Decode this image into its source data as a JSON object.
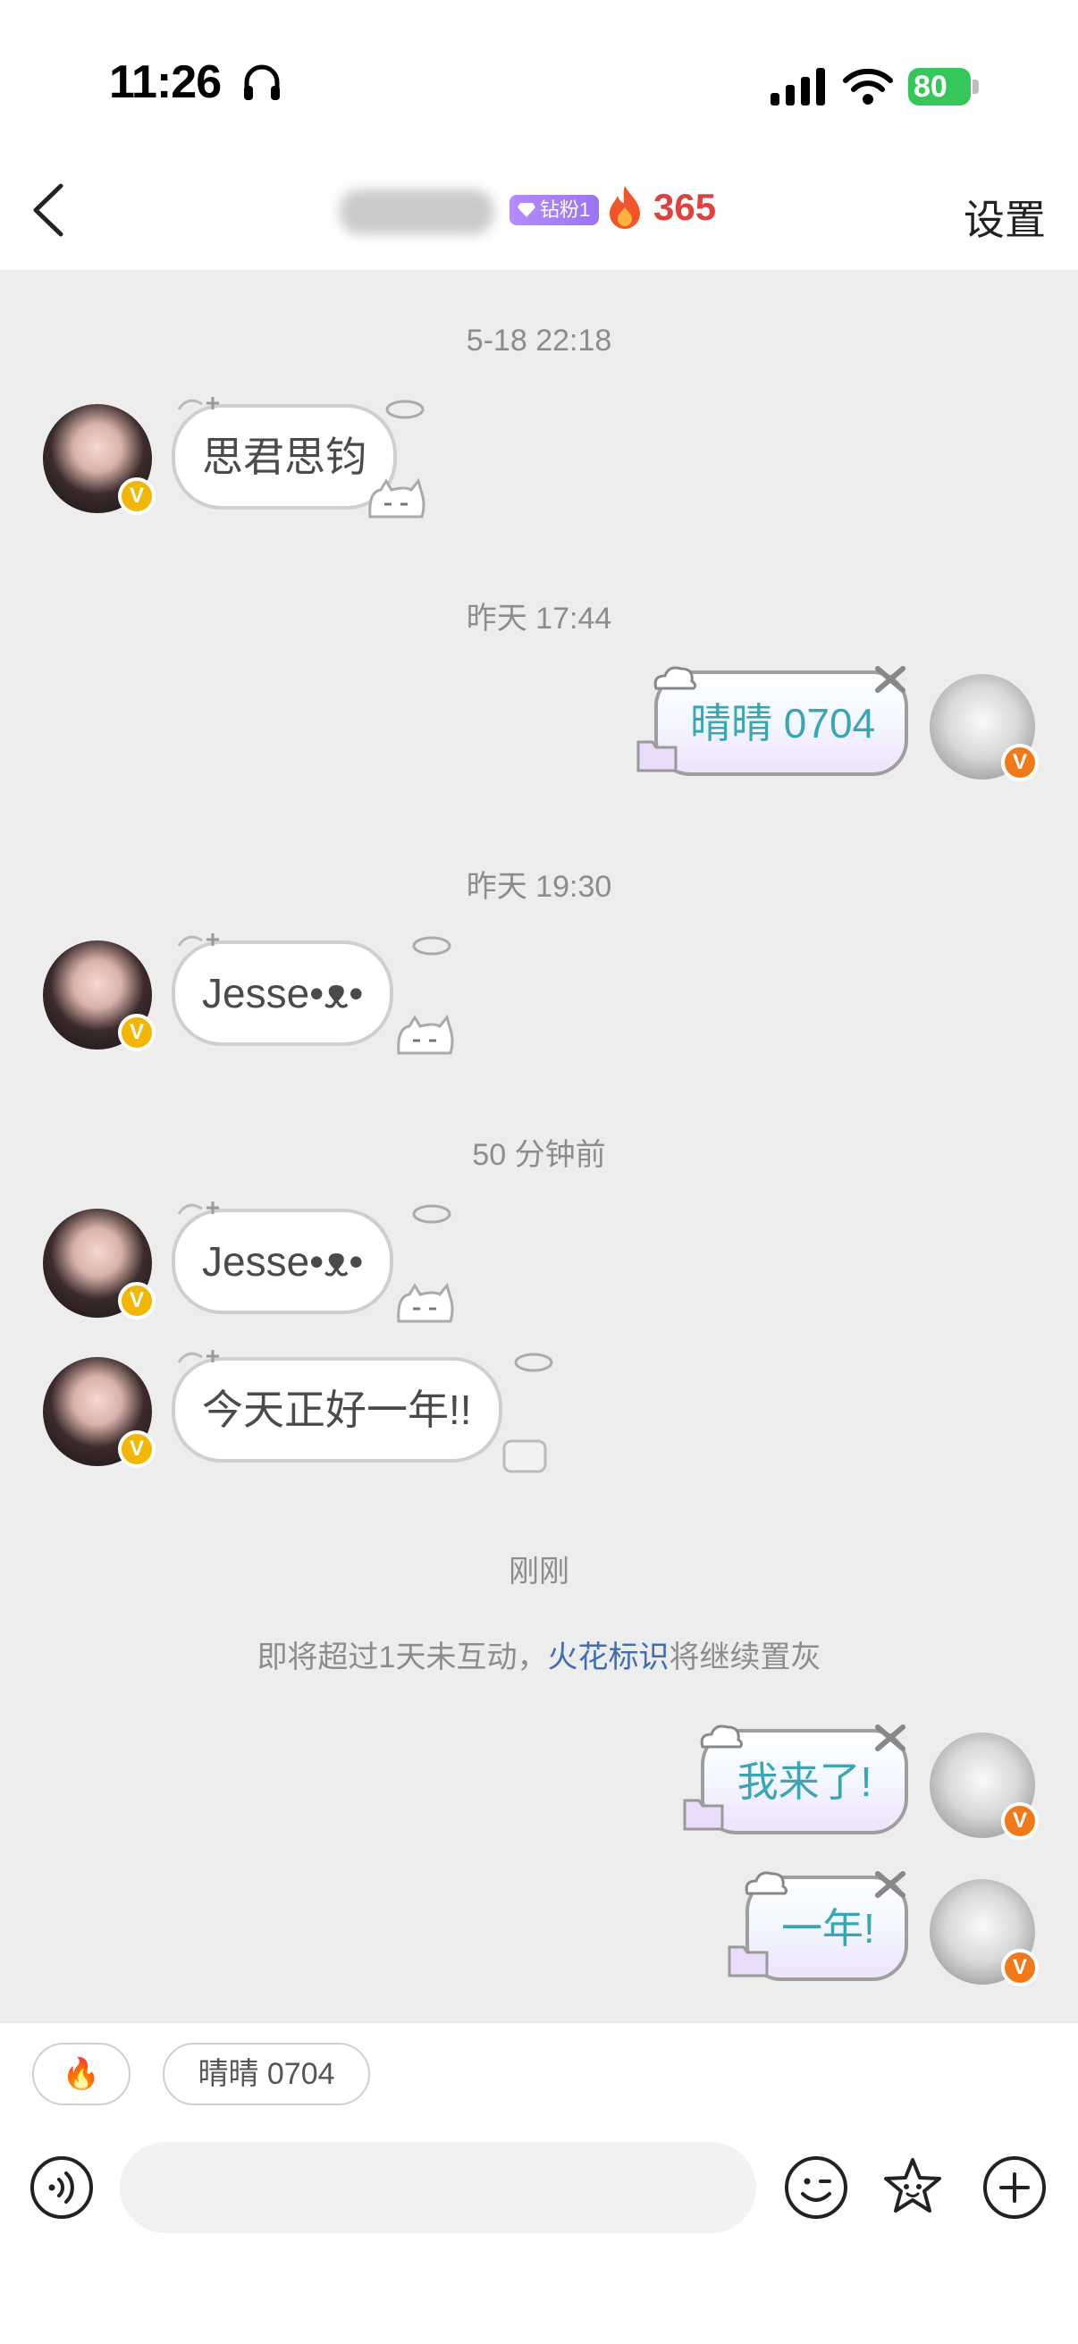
{
  "status_bar": {
    "time": "11:26",
    "battery": "80"
  },
  "header": {
    "fan_badge": "钻粉1",
    "streak_count": "365",
    "settings_label": "设置"
  },
  "messages": {
    "ts1": "5-18 22:18",
    "m1": "思君思钧",
    "ts2": "昨天 17:44",
    "m2": "晴晴 0704",
    "ts3": "昨天 19:30",
    "m3": "Jesse•ᴥ•",
    "ts4": "50 分钟前",
    "m4": "Jesse•ᴥ•",
    "m5": "今天正好一年!!",
    "ts5": "刚刚",
    "notice_before": "即将超过1天未互动，",
    "notice_link": "火花标识",
    "notice_after": "将继续置灰",
    "m6": "我来了!",
    "m7": "一年!"
  },
  "quick_replies": {
    "flame": "🔥",
    "name": "晴晴 0704"
  },
  "colors": {
    "chat_bg": "#ededed",
    "streak_red": "#e0413c",
    "link_blue": "#3f6fb2",
    "sent_text": "#3aa6b3",
    "fan_badge": "#a97ff5"
  }
}
